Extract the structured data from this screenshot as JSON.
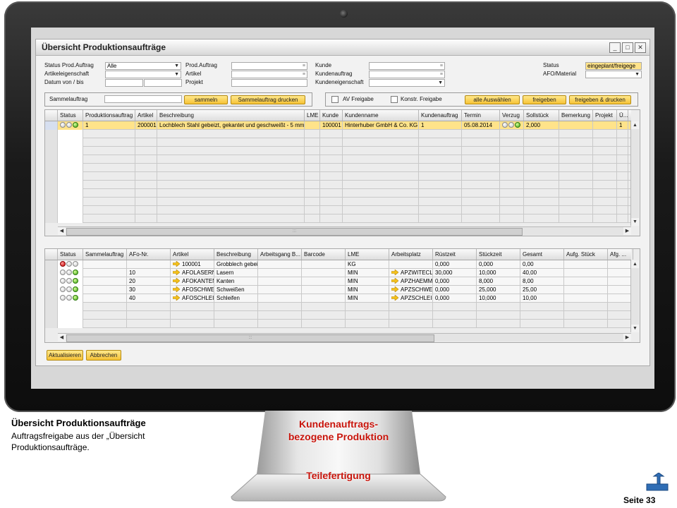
{
  "window": {
    "title": "Übersicht Produktionsaufträge",
    "buttons": [
      "minimize",
      "maximize",
      "close"
    ]
  },
  "filters": {
    "status_prod_label": "Status Prod.Auftrag",
    "status_prod_value": "Alle",
    "artikeleigenschaft_label": "Artikeleigenschaft",
    "datum_label": "Datum von / bis",
    "prod_auftrag_label": "Prod.Auftrag",
    "artikel_label": "Artikel",
    "projekt_label": "Projekt",
    "kunde_label": "Kunde",
    "kundenauftrag_label": "Kundenauftrag",
    "kundeneigenschaft_label": "Kundeneigenschaft",
    "status_label": "Status",
    "status_value": "eingeplant/freigege",
    "afo_material_label": "AFO/Material"
  },
  "toolbar": {
    "sammelauftrag_label": "Sammelauftrag",
    "sammeln": "sammeln",
    "sammelauftrag_drucken": "Sammelauftrag drucken",
    "av_freigabe": "AV Freigabe",
    "konstr_freigabe": "Konstr. Freigabe",
    "alle_auswaehlen": "alle Auswählen",
    "freigeben": "freigeben",
    "freigeben_drucken": "freigeben & drucken"
  },
  "top_grid": {
    "columns": [
      "Status",
      "Produktionsauftrag",
      "Artikel",
      "Beschreibung",
      "LME",
      "Kunde",
      "Kundenname",
      "Kundenauftrag",
      "Termin",
      "Verzug",
      "Sollstück",
      "Bemerkung",
      "Projekt",
      "Ü..."
    ],
    "rows": [
      {
        "status": [
          "grey",
          "grey",
          "green"
        ],
        "produktionsauftrag": "1",
        "artikel": "200001",
        "beschreibung": "Lochblech Stahl gebeizt, gekantet und geschweißt - 5 mm",
        "lme": "",
        "kunde": "100001",
        "kundenname": "Hinterhuber GmbH & Co. KG",
        "kundenauftrag": "1",
        "termin": "05.08.2014",
        "verzug": [
          "grey",
          "grey",
          "green"
        ],
        "sollstueck": "2,000",
        "bemerkung": "",
        "projekt": "",
        "ue": "1"
      }
    ]
  },
  "bottom_grid": {
    "columns": [
      "Status",
      "Sammelauftrag",
      "AFo-Nr.",
      "Artikel",
      "Beschreibung",
      "Arbeitsgang B...",
      "Barcode",
      "LME",
      "Arbeitsplatz",
      "Rüstzeit",
      "Stückzeit",
      "Gesamt",
      "Aufg. Stück",
      "Afg. ..."
    ],
    "rows": [
      {
        "status": [
          "red",
          "grey",
          "grey"
        ],
        "sammelauftrag": "",
        "afo_nr": "",
        "artikel": "100001",
        "beschreibung": "Grobblech gebeiz",
        "arbeitsgang": "",
        "barcode": "",
        "lme": "KG",
        "arbeitsplatz": "",
        "ruestzeit": "0,000",
        "stueckzeit": "0,000",
        "gesamt": "0,00"
      },
      {
        "status": [
          "grey",
          "grey",
          "green"
        ],
        "sammelauftrag": "",
        "afo_nr": "10",
        "artikel": "AFOLASERN",
        "beschreibung": "Lasern",
        "arbeitsgang": "",
        "barcode": "",
        "lme": "MIN",
        "arbeitsplatz": "APZWITECLA",
        "ruestzeit": "30,000",
        "stueckzeit": "10,000",
        "gesamt": "40,00"
      },
      {
        "status": [
          "grey",
          "grey",
          "green"
        ],
        "sammelauftrag": "",
        "afo_nr": "20",
        "artikel": "AFOKANTEN",
        "beschreibung": "Kanten",
        "arbeitsgang": "",
        "barcode": "",
        "lme": "MIN",
        "arbeitsplatz": "APZHAEMME",
        "ruestzeit": "0,000",
        "stueckzeit": "8,000",
        "gesamt": "8,00"
      },
      {
        "status": [
          "grey",
          "grey",
          "green"
        ],
        "sammelauftrag": "",
        "afo_nr": "30",
        "artikel": "AFOSCHWEI",
        "beschreibung": "Schweißen",
        "arbeitsgang": "",
        "barcode": "",
        "lme": "MIN",
        "arbeitsplatz": "APZSCHWEI",
        "ruestzeit": "0,000",
        "stueckzeit": "25,000",
        "gesamt": "25,00"
      },
      {
        "status": [
          "grey",
          "grey",
          "green"
        ],
        "sammelauftrag": "",
        "afo_nr": "40",
        "artikel": "AFOSCHLEIF",
        "beschreibung": "Schleifen",
        "arbeitsgang": "",
        "barcode": "",
        "lme": "MIN",
        "arbeitsplatz": "APZSCHLEIF",
        "ruestzeit": "0,000",
        "stueckzeit": "10,000",
        "gesamt": "10,00"
      }
    ]
  },
  "footer_buttons": {
    "aktualisieren": "Aktualisieren",
    "abbrechen": "Abbrechen"
  },
  "caption": {
    "title": "Übersicht Produktionsaufträge",
    "body": "Auftragsfreigabe aus der „Übersicht Produktionsaufträge."
  },
  "stand": {
    "line1": "Kundenauftrags-",
    "line2": "bezogene Produktion",
    "teilefertigung": "Teilefertigung"
  },
  "page": {
    "label": "Seite 33"
  },
  "colors": {
    "accent_button": "#f6c235",
    "selected_row": "#ffe38a",
    "stand_text": "#c8140b",
    "nav_icon": "#2f6db5"
  }
}
